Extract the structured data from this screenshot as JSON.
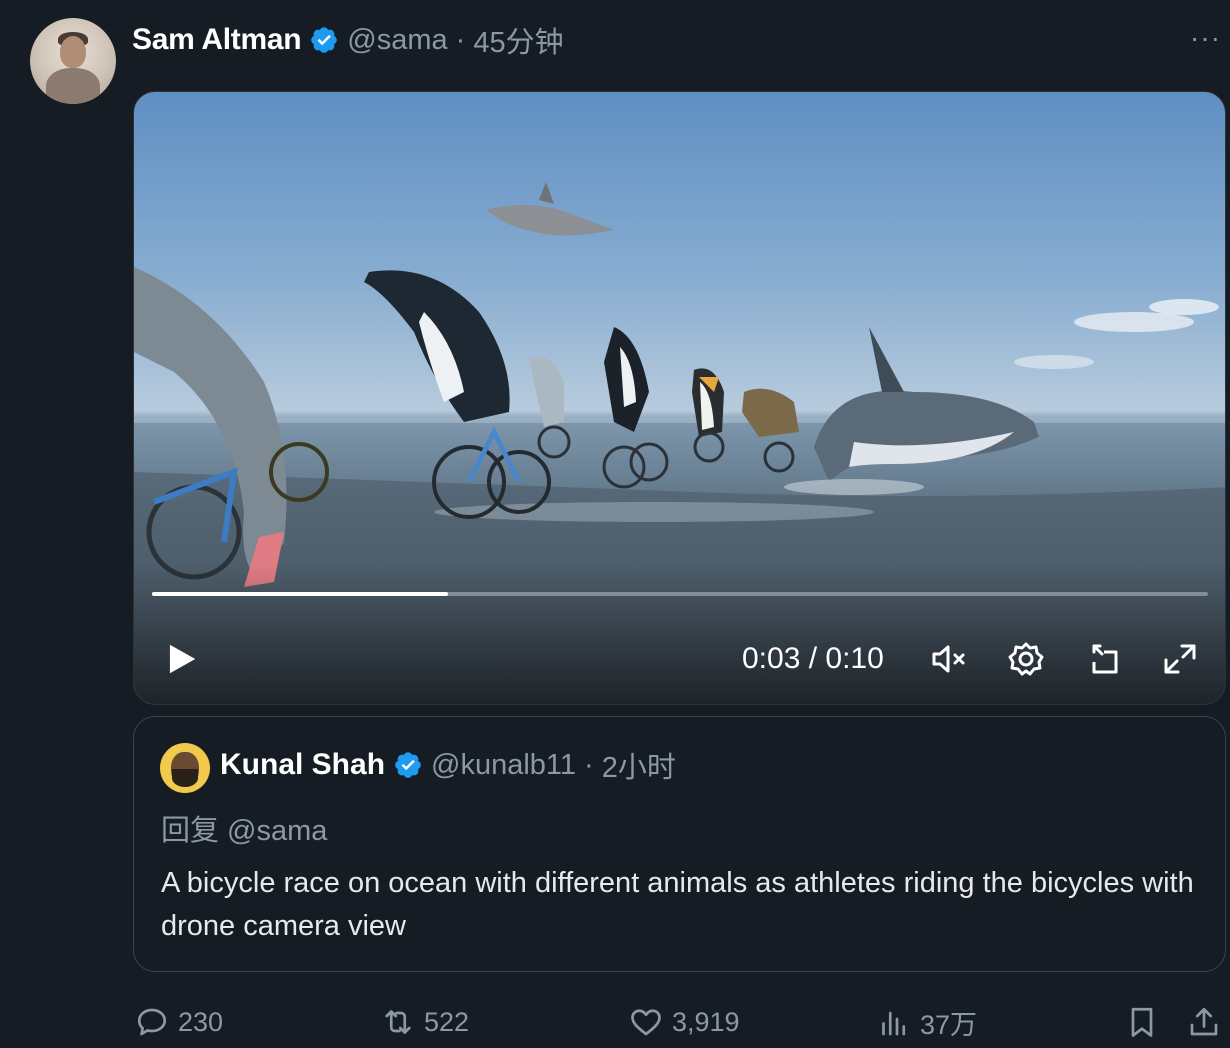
{
  "post": {
    "author_name": "Sam Altman",
    "author_handle": "@sama",
    "separator": "·",
    "time": "45分钟",
    "more_label": "···"
  },
  "video": {
    "time_display": "0:03 / 0:10",
    "progress": 0.28,
    "muted": true
  },
  "quote": {
    "author_name": "Kunal Shah",
    "author_handle": "@kunalb11",
    "separator": "·",
    "time": "2小时",
    "reply_to": "回复 @sama",
    "text": "A bicycle race on ocean with different animals as athletes riding the bicycles with drone camera view"
  },
  "actions": {
    "replies": "230",
    "reposts": "522",
    "likes": "3,919",
    "views": "37万"
  },
  "colors": {
    "background": "#151c24",
    "verified": "#1d9bf0",
    "muted_text": "#8b98a5"
  }
}
